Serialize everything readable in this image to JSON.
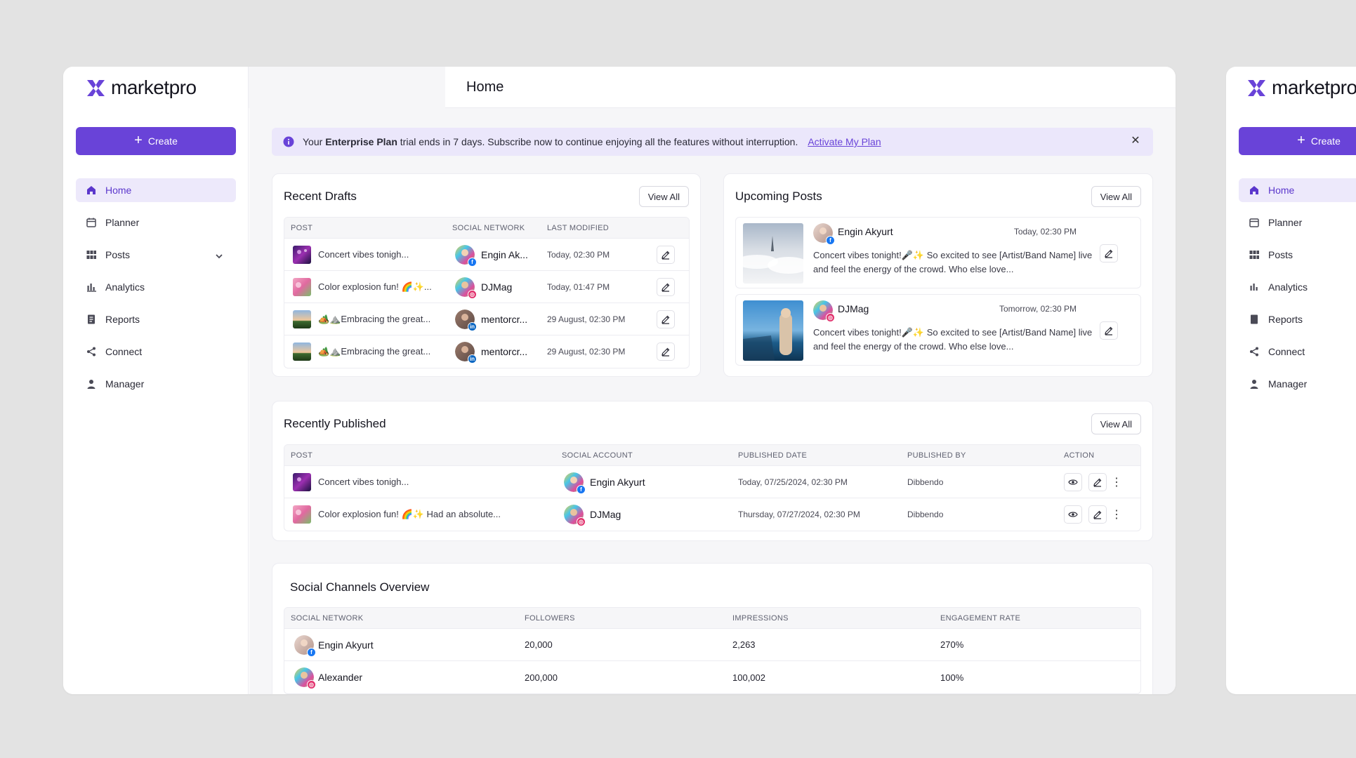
{
  "app": {
    "logo_bold": "market",
    "logo_light": "pro",
    "create_label": "Create"
  },
  "nav": {
    "items": [
      {
        "label": "Home",
        "icon": "home-icon"
      },
      {
        "label": "Planner",
        "icon": "calendar-icon"
      },
      {
        "label": "Posts",
        "icon": "grid-icon"
      },
      {
        "label": "Analytics",
        "icon": "bar-chart-icon"
      },
      {
        "label": "Reports",
        "icon": "report-icon"
      },
      {
        "label": "Connect",
        "icon": "share-icon"
      },
      {
        "label": "Manager",
        "icon": "user-icon"
      }
    ]
  },
  "header": {
    "title": "Home"
  },
  "banner": {
    "pre": "Your ",
    "plan": "Enterprise Plan",
    "post": " trial ends in 7 days. Subscribe now to continue enjoying all the features without interruption.",
    "link": "Activate My Plan",
    "close": "✕"
  },
  "drafts": {
    "title": "Recent Drafts",
    "view_all": "View All",
    "columns": [
      "POST",
      "SOCIAL NETWORK",
      "LAST MODIFIED"
    ],
    "rows": [
      {
        "post": "Concert vibes tonigh...",
        "account": "Engin Ak...",
        "network": "fb",
        "date": "Today, 02:30 PM"
      },
      {
        "post": "Color explosion fun! 🌈✨...",
        "account": "DJMag",
        "network": "ig",
        "date": "Today, 01:47 PM"
      },
      {
        "post": "🏕️⛰️Embracing the great...",
        "account": "mentorcr...",
        "network": "li",
        "date": "29 August, 02:30 PM"
      },
      {
        "post": "🏕️⛰️Embracing the great...",
        "account": "mentorcr...",
        "network": "li",
        "date": "29 August, 02:30 PM"
      }
    ]
  },
  "upcoming": {
    "title": "Upcoming Posts",
    "view_all": "View All",
    "items": [
      {
        "name": "Engin Akyurt",
        "network": "fb",
        "time": "Today, 02:30 PM",
        "text": "Concert vibes tonight!🎤✨ So excited to see [Artist/Band Name] live and feel the energy of the crowd. Who else love..."
      },
      {
        "name": "DJMag",
        "network": "ig",
        "time": "Tomorrow, 02:30 PM",
        "text": "Concert vibes tonight!🎤✨ So excited to see [Artist/Band Name] live and feel the energy of the crowd. Who else love..."
      }
    ]
  },
  "published": {
    "title": "Recently Published",
    "view_all": "View All",
    "columns": [
      "POST",
      "SOCIAL ACCOUNT",
      "PUBLISHED DATE",
      "PUBLISHED BY",
      "ACTION"
    ],
    "rows": [
      {
        "post": "Concert vibes tonigh...",
        "account": "Engin Akyurt",
        "network": "fb",
        "date": "Today, 07/25/2024, 02:30 PM",
        "by": "Dibbendo"
      },
      {
        "post": "Color explosion fun! 🌈✨ Had an absolute...",
        "account": "DJMag",
        "network": "ig",
        "date": "Thursday, 07/27/2024, 02:30 PM",
        "by": "Dibbendo"
      }
    ]
  },
  "channels": {
    "title": "Social Channels Overview",
    "columns": [
      "SOCIAL NETWORK",
      "FOLLOWERS",
      "IMPRESSIONS",
      "ENGAGEMENT RATE"
    ],
    "rows": [
      {
        "name": "Engin Akyurt",
        "network": "fb",
        "followers": "20,000",
        "impressions": "2,263",
        "engagement": "270%"
      },
      {
        "name": "Alexander",
        "network": "ig",
        "followers": "200,000",
        "impressions": "100,002",
        "engagement": "100%"
      }
    ]
  },
  "colors": {
    "accent": "#6943d8",
    "accent_soft": "#ede9fb",
    "banner_bg": "#ebe7fb",
    "facebook": "#1877f2",
    "instagram": "#e1306c",
    "linkedin": "#0a66c2"
  }
}
